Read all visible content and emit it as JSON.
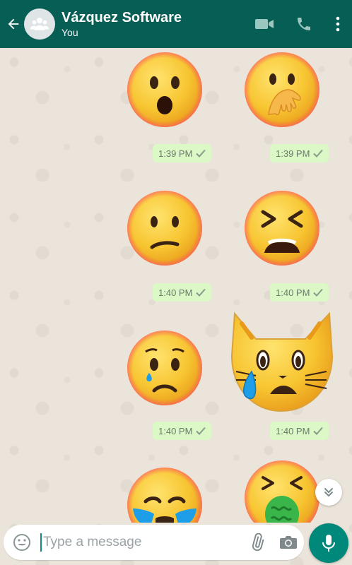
{
  "header": {
    "title": "Vázquez Software",
    "subtitle": "You"
  },
  "messages": [
    {
      "sticker": "hushed-face",
      "time": "1:39 PM"
    },
    {
      "sticker": "face-with-hand-over-mouth",
      "time": "1:39 PM"
    },
    {
      "sticker": "confused-face",
      "time": "1:40 PM"
    },
    {
      "sticker": "tired-face",
      "time": "1:40 PM"
    },
    {
      "sticker": "sad-but-relieved-face",
      "time": "1:40 PM"
    },
    {
      "sticker": "crying-cat-face",
      "time": "1:40 PM"
    },
    {
      "sticker": "loudly-crying-face",
      "time": ""
    },
    {
      "sticker": "vomiting-face",
      "time": ""
    }
  ],
  "composer": {
    "placeholder": "Type a message"
  },
  "colors": {
    "appbar": "#075e54",
    "bubble": "#dcf8c6",
    "accent": "#00897b"
  }
}
